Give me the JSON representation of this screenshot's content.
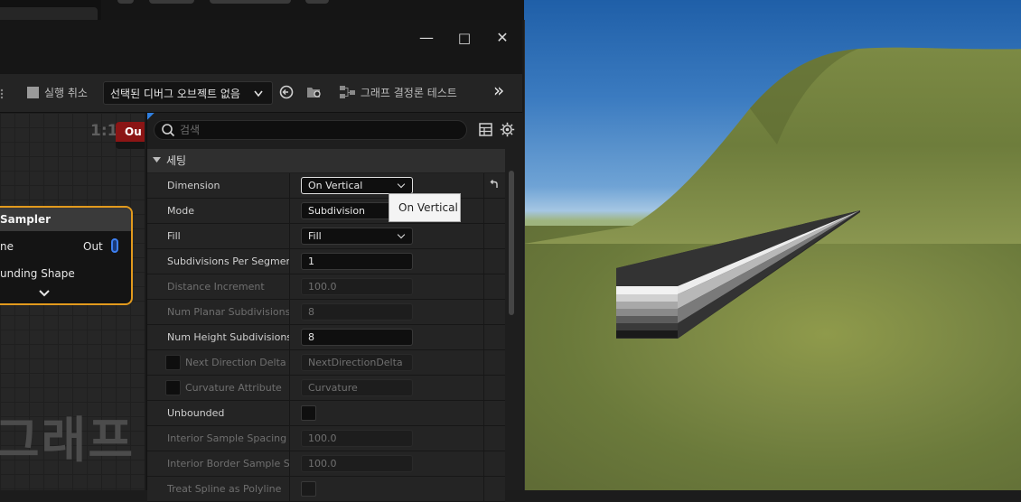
{
  "window": {
    "controls": {
      "minimize": "—",
      "maximize": "□",
      "close": "✕"
    }
  },
  "toolbar": {
    "cancel_run_label": "실행 취소",
    "debug_object_dropdown": "선택된 디버그 오브젝트 없음",
    "determinism_test_label": "그래프 결정론 테스트",
    "overflow_label": "»"
  },
  "graph": {
    "zoom_label": "1:1",
    "output_node_label": "Ou",
    "sampler_node": {
      "title": "Sampler",
      "pin_in_label": "ne",
      "pin_out_label": "Out",
      "pin_bounding_label": "unding Shape"
    },
    "watermark": "그래프"
  },
  "details": {
    "search_placeholder": "검색",
    "section_title": "세팅",
    "rows": [
      {
        "label": "Dimension",
        "value": "On Vertical",
        "kind": "combo",
        "enabled": true,
        "has_reset": true
      },
      {
        "label": "Mode",
        "value": "Subdivision",
        "kind": "combo",
        "enabled": true
      },
      {
        "label": "Fill",
        "value": "Fill",
        "kind": "combo",
        "enabled": true
      },
      {
        "label": "Subdivisions Per Segment",
        "value": "1",
        "kind": "number",
        "enabled": true
      },
      {
        "label": "Distance Increment",
        "value": "100.0",
        "kind": "number",
        "enabled": false
      },
      {
        "label": "Num Planar Subdivisions",
        "value": "8",
        "kind": "number",
        "enabled": false
      },
      {
        "label": "Num Height Subdivisions",
        "value": "8",
        "kind": "number",
        "enabled": true
      },
      {
        "label": "Next Direction Delta...",
        "value": "NextDirectionDelta",
        "kind": "attribute",
        "enabled": false
      },
      {
        "label": "Curvature Attribute",
        "value": "Curvature",
        "kind": "attribute",
        "enabled": false
      },
      {
        "label": "Unbounded",
        "value": "",
        "kind": "checkbox",
        "enabled": true
      },
      {
        "label": "Interior Sample Spacing",
        "value": "100.0",
        "kind": "number",
        "enabled": false
      },
      {
        "label": "Interior Border Sample S...",
        "value": "100.0",
        "kind": "number",
        "enabled": false
      },
      {
        "label": "Treat Spline as Polyline",
        "value": "",
        "kind": "checkbox",
        "enabled": false
      }
    ],
    "tooltip": "On Vertical"
  },
  "colors": {
    "node_highlight": "#e29a1d",
    "output_node_header": "#8b1515",
    "panel_bg": "#242424",
    "field_bg": "#0f0f0f"
  }
}
